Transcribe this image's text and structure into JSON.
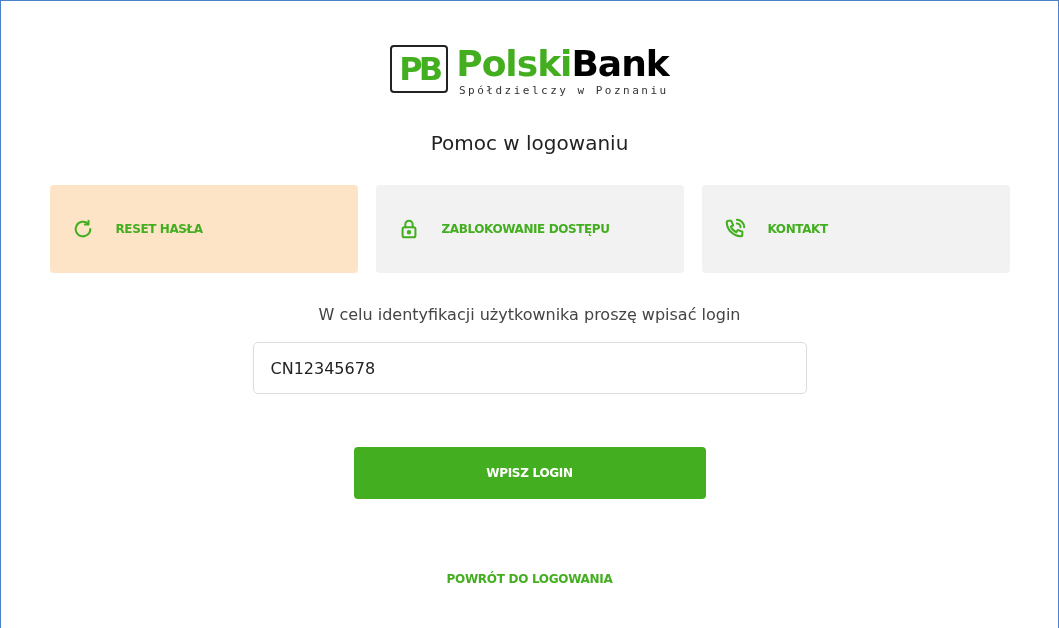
{
  "logo": {
    "mark": "PB",
    "name_first": "Polski",
    "name_second": "Bank",
    "subtitle": "Spółdzielczy w Poznaniu"
  },
  "title": "Pomoc w logowaniu",
  "tabs": [
    {
      "kind": "reset",
      "label": "RESET HASŁA",
      "selected": true
    },
    {
      "kind": "lock",
      "label": "ZABLOKOWANIE DOSTĘPU",
      "selected": false
    },
    {
      "kind": "phone",
      "label": "KONTAKT",
      "selected": false
    }
  ],
  "instruction": "W celu identyfikacji użytkownika proszę wpisać login",
  "login_field": {
    "value": "CN12345678"
  },
  "submit_button": "WPISZ LOGIN",
  "back_link": "POWRÓT DO LOGOWANIA"
}
